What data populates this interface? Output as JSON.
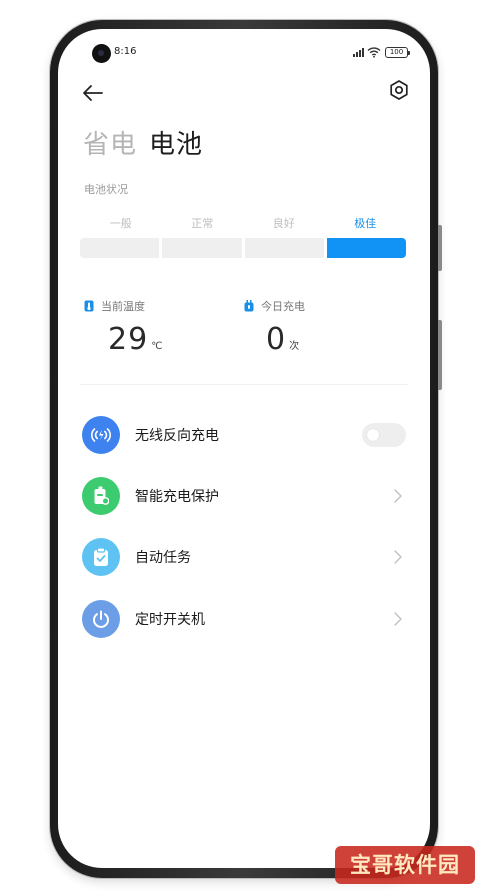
{
  "status_bar": {
    "time": "8:16",
    "battery": "100"
  },
  "header": {
    "tabs": [
      {
        "label": "省电",
        "active": false
      },
      {
        "label": "电池",
        "active": true
      }
    ]
  },
  "battery_status": {
    "label": "电池状况",
    "levels": [
      "一般",
      "正常",
      "良好",
      "极佳"
    ],
    "selected_level": "极佳"
  },
  "stats": {
    "temperature": {
      "label": "当前温度",
      "value": "29",
      "unit": "℃"
    },
    "charges_today": {
      "label": "今日充电",
      "value": "0",
      "unit": "次"
    }
  },
  "settings": [
    {
      "label": "无线反向充电",
      "icon": "wireless-charge-icon",
      "color": "#3d82ee",
      "control": "toggle",
      "toggle_on": false
    },
    {
      "label": "智能充电保护",
      "icon": "battery-shield-icon",
      "color": "#3ccb6e",
      "control": "chevron"
    },
    {
      "label": "自动任务",
      "icon": "task-clipboard-icon",
      "color": "#5ec3f2",
      "control": "chevron"
    },
    {
      "label": "定时开关机",
      "icon": "power-icon",
      "color": "#6b9ee6",
      "control": "chevron"
    }
  ],
  "colors": {
    "accent": "#1192f5",
    "selected_text": "#1a8fe8"
  },
  "watermark": {
    "text": "宝哥软件园"
  }
}
